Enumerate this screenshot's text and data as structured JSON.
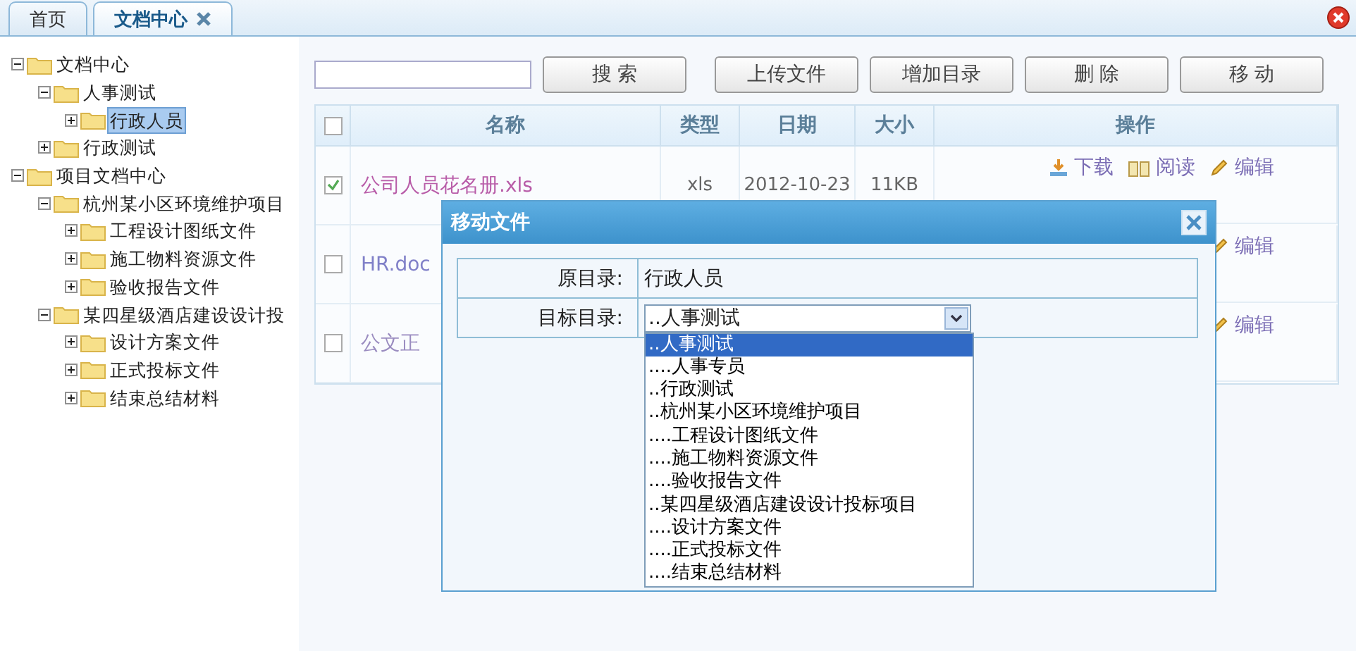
{
  "tabs": [
    {
      "label": "首页",
      "selected": false,
      "closable": false
    },
    {
      "label": "文档中心",
      "selected": true,
      "closable": true
    }
  ],
  "tree": [
    {
      "label": "文档中心",
      "expanded": true,
      "selected": false,
      "children": [
        {
          "label": "人事测试",
          "expanded": true,
          "selected": false,
          "children": [
            {
              "label": "行政人员",
              "expanded": false,
              "selected": true
            }
          ]
        },
        {
          "label": "行政测试",
          "expanded": false,
          "selected": false
        }
      ]
    },
    {
      "label": "项目文档中心",
      "expanded": true,
      "selected": false,
      "children": [
        {
          "label": "杭州某小区环境维护项目",
          "expanded": true,
          "selected": false,
          "children": [
            {
              "label": "工程设计图纸文件",
              "expanded": false,
              "selected": false
            },
            {
              "label": "施工物料资源文件",
              "expanded": false,
              "selected": false
            },
            {
              "label": "验收报告文件",
              "expanded": false,
              "selected": false
            }
          ]
        },
        {
          "label": "某四星级酒店建设设计投",
          "expanded": true,
          "selected": false,
          "children": [
            {
              "label": "设计方案文件",
              "expanded": false,
              "selected": false
            },
            {
              "label": "正式投标文件",
              "expanded": false,
              "selected": false
            },
            {
              "label": "结束总结材料",
              "expanded": false,
              "selected": false
            }
          ]
        }
      ]
    }
  ],
  "toolbar": {
    "buttons": [
      "搜 索",
      "上传文件",
      "增加目录",
      "删 除",
      "移 动"
    ]
  },
  "table": {
    "all_checked": false,
    "columns": [
      "名称",
      "类型",
      "日期",
      "大小",
      "操作"
    ],
    "rows": [
      {
        "checked": true,
        "name": "公司人员花名册.xls",
        "color": "#b85ca8",
        "type": "xls",
        "date": "2012-10-23",
        "size": "11KB",
        "actions": [
          {
            "kind": "download",
            "label": "下载"
          },
          {
            "kind": "read",
            "label": "阅读"
          },
          {
            "kind": "edit",
            "label": "编辑"
          }
        ]
      },
      {
        "checked": false,
        "name": "HR.doc",
        "color": "#8080c8",
        "actions": [
          {
            "kind": "edit",
            "label": "编辑"
          }
        ]
      },
      {
        "checked": false,
        "name": "公文正",
        "color": "#9a8cc0",
        "actions": [
          {
            "kind": "edit",
            "label": "编辑"
          }
        ]
      }
    ]
  },
  "dialog": {
    "title": "移动文件",
    "fields": [
      {
        "kind": "text",
        "label": "原目录:",
        "value": "行政人员"
      },
      {
        "kind": "select",
        "label": "目标目录:",
        "value": "..人事测试"
      }
    ],
    "options": [
      {
        "label": "..人事测试",
        "selected": true
      },
      {
        "label": "....人事专员",
        "selected": false
      },
      {
        "label": "..行政测试",
        "selected": false
      },
      {
        "label": "..杭州某小区环境维护项目",
        "selected": false
      },
      {
        "label": "....工程设计图纸文件",
        "selected": false
      },
      {
        "label": "....施工物料资源文件",
        "selected": false
      },
      {
        "label": "....验收报告文件",
        "selected": false
      },
      {
        "label": "..某四星级酒店建设设计投标项目",
        "selected": false
      },
      {
        "label": "....设计方案文件",
        "selected": false
      },
      {
        "label": "....正式投标文件",
        "selected": false
      },
      {
        "label": "....结束总结材料",
        "selected": false
      }
    ]
  }
}
